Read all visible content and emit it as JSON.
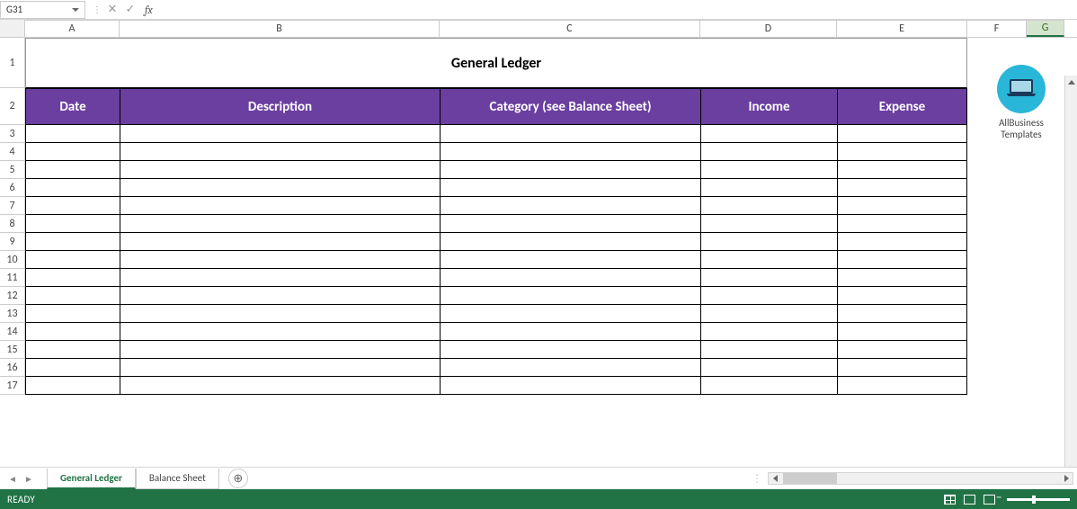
{
  "name_box": "G31",
  "formula_value": "",
  "columns": [
    "A",
    "B",
    "C",
    "D",
    "E",
    "F",
    "G"
  ],
  "selected_column": "G",
  "rows": [
    1,
    2,
    3,
    4,
    5,
    6,
    7,
    8,
    9,
    10,
    11,
    12,
    13,
    14,
    15,
    16,
    17
  ],
  "title": "General Ledger",
  "headers": {
    "date": "Date",
    "description": "Description",
    "category": "Category (see Balance Sheet)",
    "income": "Income",
    "expense": "Expense"
  },
  "logo": {
    "line1": "AllBusiness",
    "line2": "Templates"
  },
  "sheets": {
    "active": "General Ledger",
    "other": "Balance Sheet"
  },
  "status": "READY"
}
